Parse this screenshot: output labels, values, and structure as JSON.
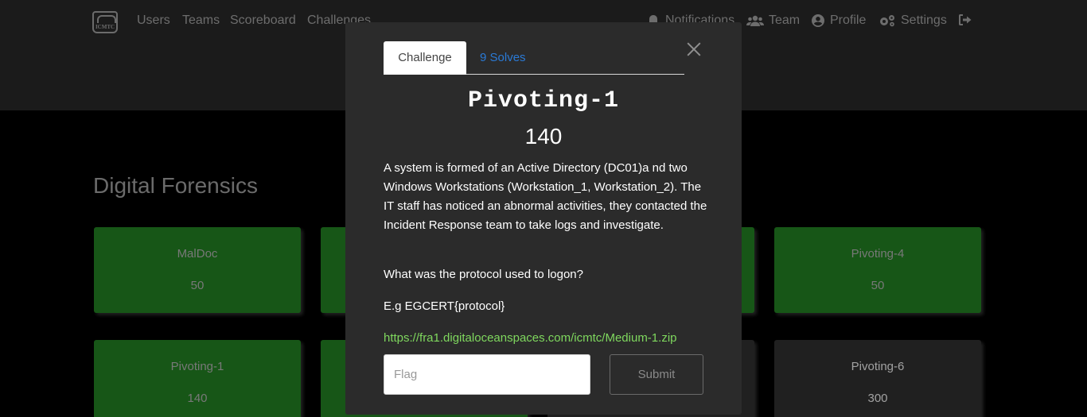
{
  "navbar": {
    "logo_text": "ICMTC",
    "left_links": [
      "Users",
      "Teams",
      "Scoreboard",
      "Challenges"
    ],
    "right_links": [
      {
        "label": "Notifications",
        "icon": "bell-icon"
      },
      {
        "label": "Team",
        "icon": "users-icon"
      },
      {
        "label": "Profile",
        "icon": "user-circle-icon"
      },
      {
        "label": "Settings",
        "icon": "gears-icon"
      }
    ],
    "logout_icon": "sign-out-icon"
  },
  "category": {
    "title": "Digital Forensics"
  },
  "cards": [
    {
      "name": "MalDoc",
      "value": "50",
      "status": "solved"
    },
    {
      "name": "Pivoting-4",
      "value": "50",
      "status": "solved"
    },
    {
      "name": "Pivoting-1",
      "value": "140",
      "status": "solved"
    },
    {
      "name": "Pivoting-6",
      "value": "300",
      "status": "unsolved"
    }
  ],
  "modal": {
    "tabs": {
      "challenge": "Challenge",
      "solves": "9 Solves"
    },
    "title": "Pivoting-1",
    "value": "140",
    "description": "A system is formed of an Active Directory (DC01)a nd two Windows Workstations (Workstation_1, Workstation_2). The IT staff has noticed an abnormal activities, they contacted the Incident Response team to take logs and investigate.",
    "question": "What was the protocol used to logon?",
    "example": "E.g EGCERT{protocol}",
    "download_link": "https://fra1.digitaloceanspaces.com/icmtc/Medium-1.zip",
    "flag_placeholder": "Flag",
    "submit_label": "Submit"
  },
  "colors": {
    "solved_card": "#1e6f1e",
    "link_green": "#7fd85e",
    "tab_link_blue": "#2a7ad6",
    "modal_bg": "#2b2b2b"
  }
}
